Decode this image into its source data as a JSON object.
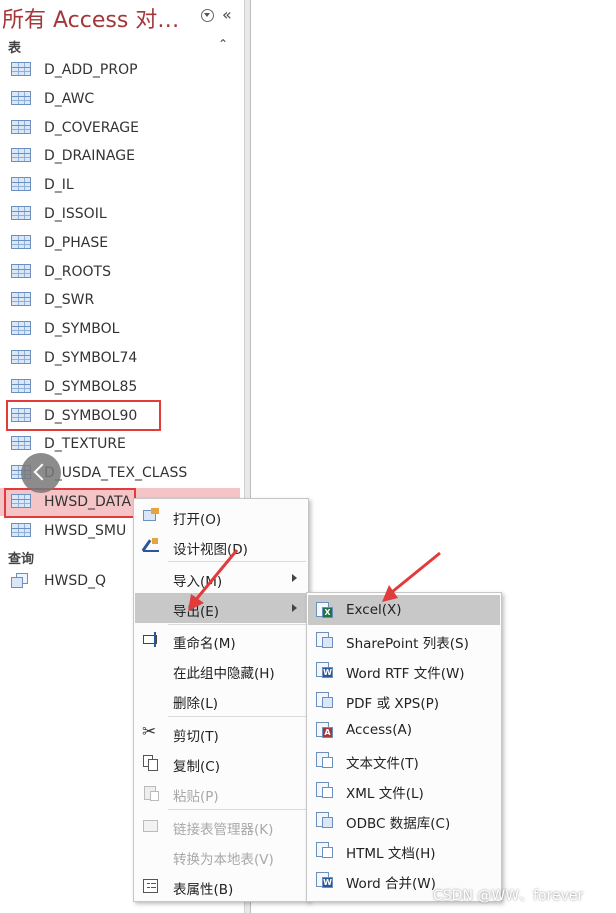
{
  "nav": {
    "title": "所有 Access 对…",
    "group_tables": "表",
    "group_queries": "查询",
    "tables": [
      "D_ADD_PROP",
      "D_AWC",
      "D_COVERAGE",
      "D_DRAINAGE",
      "D_IL",
      "D_ISSOIL",
      "D_PHASE",
      "D_ROOTS",
      "D_SWR",
      "D_SYMBOL",
      "D_SYMBOL74",
      "D_SYMBOL85",
      "D_SYMBOL90",
      "D_TEXTURE",
      "D_USDA_TEX_CLASS",
      "HWSD_DATA",
      "HWSD_SMU"
    ],
    "queries": [
      "HWSD_Q"
    ],
    "selected_item": "HWSD_DATA"
  },
  "context_menu": {
    "items": [
      {
        "label": "打开(O)",
        "icon": "open-table-icon",
        "enabled": true
      },
      {
        "label": "设计视图(D)",
        "icon": "design-view-icon",
        "enabled": true
      },
      {
        "label": "导入(M)",
        "enabled": true,
        "submenu": true
      },
      {
        "label": "导出(E)",
        "enabled": true,
        "submenu": true,
        "highlighted": true
      },
      {
        "label": "重命名(M)",
        "icon": "rename-icon",
        "enabled": true
      },
      {
        "label": "在此组中隐藏(H)",
        "enabled": true
      },
      {
        "label": "删除(L)",
        "enabled": true
      },
      {
        "label": "剪切(T)",
        "icon": "scissors-icon",
        "enabled": true
      },
      {
        "label": "复制(C)",
        "icon": "copy-icon",
        "enabled": true
      },
      {
        "label": "粘贴(P)",
        "icon": "paste-icon",
        "enabled": false
      },
      {
        "label": "链接表管理器(K)",
        "icon": "linked-table-manager-icon",
        "enabled": false
      },
      {
        "label": "转换为本地表(V)",
        "enabled": false
      },
      {
        "label": "表属性(B)",
        "icon": "table-properties-icon",
        "enabled": true
      }
    ]
  },
  "export_submenu": {
    "items": [
      {
        "label": "Excel(X)",
        "icon": "excel-icon",
        "highlighted": true
      },
      {
        "label": "SharePoint 列表(S)",
        "icon": "sharepoint-list-icon"
      },
      {
        "label": "Word RTF 文件(W)",
        "icon": "word-rtf-icon"
      },
      {
        "label": "PDF 或 XPS(P)",
        "icon": "pdf-xps-icon"
      },
      {
        "label": "Access(A)",
        "icon": "access-icon"
      },
      {
        "label": "文本文件(T)",
        "icon": "text-file-icon"
      },
      {
        "label": "XML 文件(L)",
        "icon": "xml-file-icon"
      },
      {
        "label": "ODBC 数据库(C)",
        "icon": "odbc-database-icon"
      },
      {
        "label": "HTML 文档(H)",
        "icon": "html-document-icon"
      },
      {
        "label": "Word 合并(W)",
        "icon": "word-merge-icon"
      }
    ]
  },
  "watermark": "CSDN @WW、forever",
  "colors": {
    "title": "#a4373a",
    "selection": "#f5c4c6",
    "annotation": "#e23b3b",
    "excel_green": "#1e7145",
    "word_blue": "#2b579a",
    "access_red": "#a4373a"
  }
}
